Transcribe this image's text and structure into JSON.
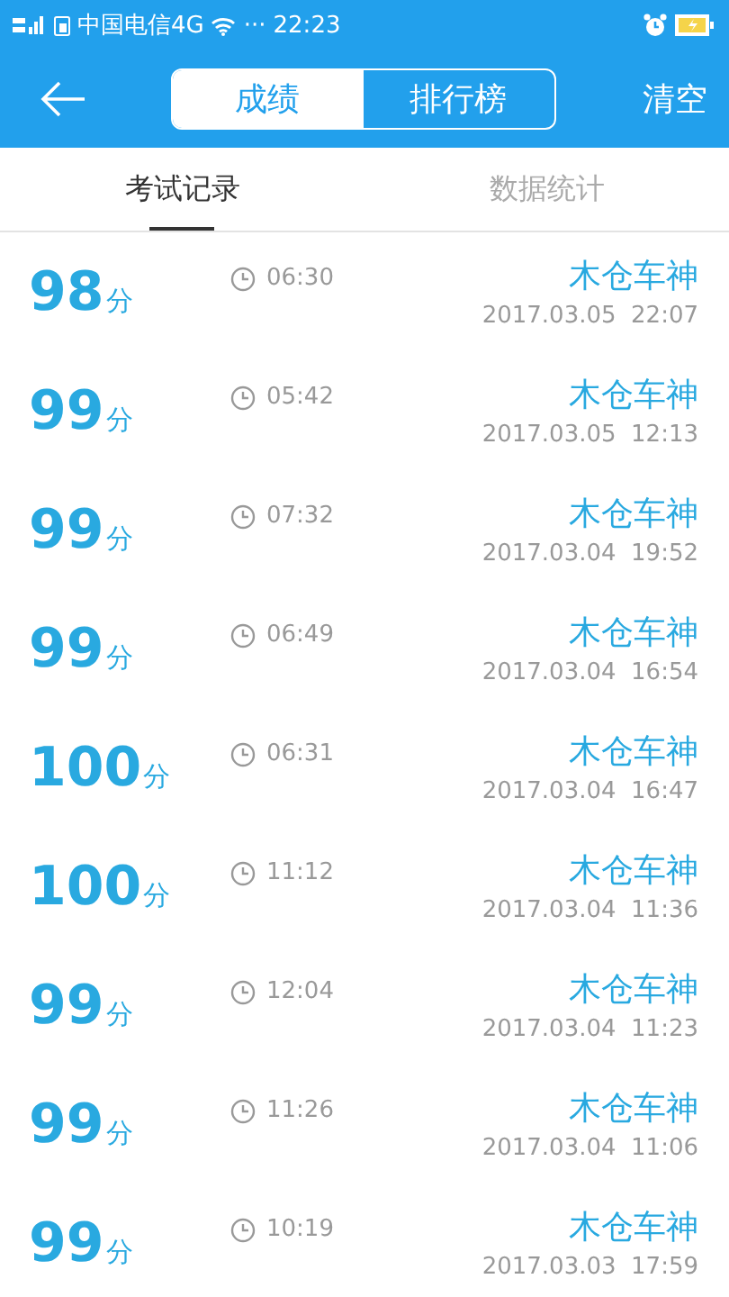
{
  "status_bar": {
    "carrier": "中国电信4G",
    "dots": "···",
    "time": "22:23"
  },
  "header": {
    "segments": [
      {
        "label": "成绩",
        "selected": true
      },
      {
        "label": "排行榜",
        "selected": false
      }
    ],
    "action": "清空"
  },
  "tabs": [
    {
      "label": "考试记录",
      "selected": true
    },
    {
      "label": "数据统计",
      "selected": false
    }
  ],
  "records": [
    {
      "score": "98",
      "unit": "分",
      "duration": "06:30",
      "name": "木仓车神",
      "date": "2017.03.05  22:07"
    },
    {
      "score": "99",
      "unit": "分",
      "duration": "05:42",
      "name": "木仓车神",
      "date": "2017.03.05  12:13"
    },
    {
      "score": "99",
      "unit": "分",
      "duration": "07:32",
      "name": "木仓车神",
      "date": "2017.03.04  19:52"
    },
    {
      "score": "99",
      "unit": "分",
      "duration": "06:49",
      "name": "木仓车神",
      "date": "2017.03.04  16:54"
    },
    {
      "score": "100",
      "unit": "分",
      "duration": "06:31",
      "name": "木仓车神",
      "date": "2017.03.04  16:47"
    },
    {
      "score": "100",
      "unit": "分",
      "duration": "11:12",
      "name": "木仓车神",
      "date": "2017.03.04  11:36"
    },
    {
      "score": "99",
      "unit": "分",
      "duration": "12:04",
      "name": "木仓车神",
      "date": "2017.03.04  11:23"
    },
    {
      "score": "99",
      "unit": "分",
      "duration": "11:26",
      "name": "木仓车神",
      "date": "2017.03.04  11:06"
    },
    {
      "score": "99",
      "unit": "分",
      "duration": "10:19",
      "name": "木仓车神",
      "date": "2017.03.03  17:59"
    }
  ]
}
